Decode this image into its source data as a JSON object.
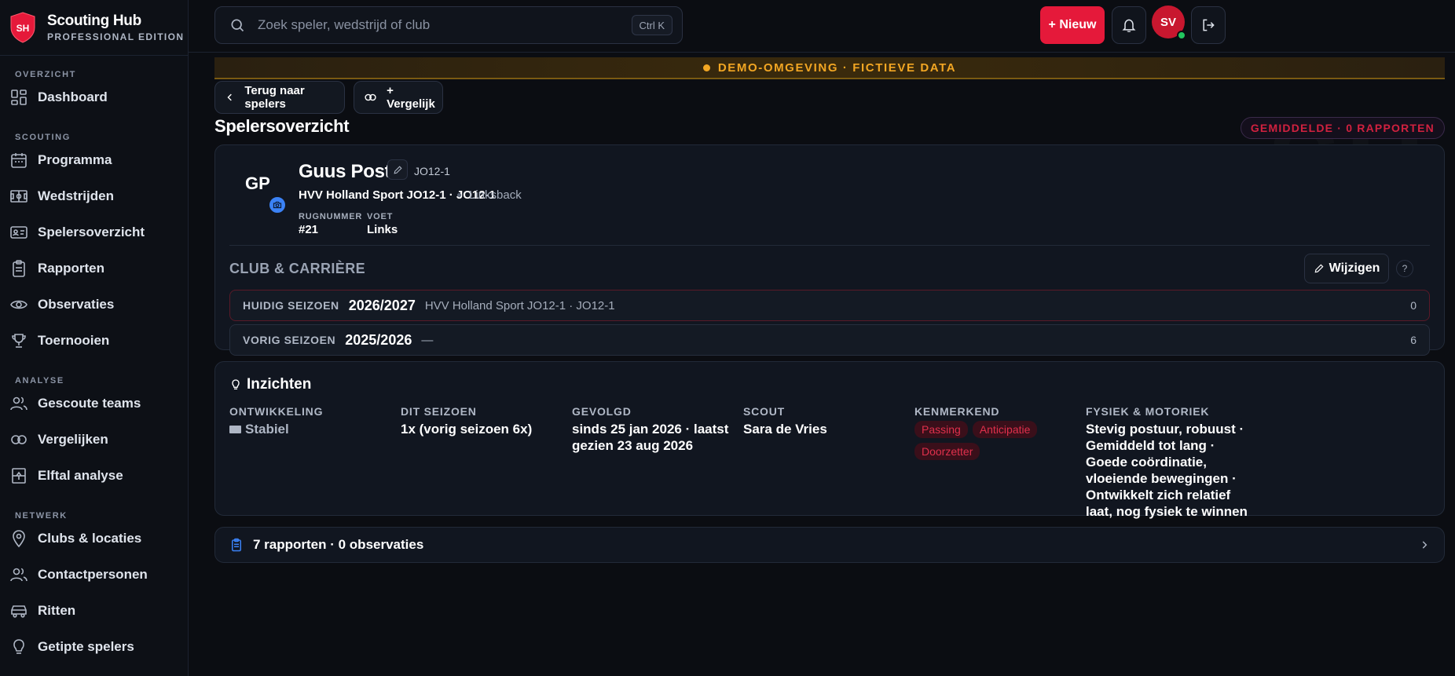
{
  "brand": {
    "logo_text": "SH",
    "title": "Scouting Hub",
    "subtitle": "PROFESSIONAL EDITION"
  },
  "sidebar": {
    "sections": [
      {
        "label": "OVERZICHT",
        "items": [
          {
            "label": "Dashboard",
            "icon": "grid-icon"
          }
        ]
      },
      {
        "label": "SCOUTING",
        "items": [
          {
            "label": "Programma",
            "icon": "calendar-icon"
          },
          {
            "label": "Wedstrijden",
            "icon": "pitch-icon"
          },
          {
            "label": "Spelersoverzicht",
            "icon": "id-card-icon"
          },
          {
            "label": "Rapporten",
            "icon": "clipboard-icon"
          },
          {
            "label": "Observaties",
            "icon": "eye-icon"
          },
          {
            "label": "Toernooien",
            "icon": "trophy-icon"
          }
        ]
      },
      {
        "label": "ANALYSE",
        "items": [
          {
            "label": "Gescoute teams",
            "icon": "users-icon"
          },
          {
            "label": "Vergelijken",
            "icon": "compare-icon"
          },
          {
            "label": "Elftal analyse",
            "icon": "formation-icon"
          }
        ]
      },
      {
        "label": "NETWERK",
        "items": [
          {
            "label": "Clubs & locaties",
            "icon": "map-pin-icon"
          },
          {
            "label": "Contactpersonen",
            "icon": "contacts-icon"
          },
          {
            "label": "Ritten",
            "icon": "car-icon"
          },
          {
            "label": "Getipte spelers",
            "icon": "lightbulb-icon"
          }
        ]
      }
    ]
  },
  "topbar": {
    "search_placeholder": "Zoek speler, wedstrijd of club",
    "shortcut": "Ctrl K",
    "new_label": "+ Nieuw",
    "avatar_initials": "SV"
  },
  "banner": {
    "text": "DEMO-OMGEVING · FICTIEVE DATA"
  },
  "actions": {
    "back_label": "Terug naar spelers",
    "compare_label": "+ Vergelijk"
  },
  "page": {
    "title": "Spelersoverzicht",
    "badge": "GEMIDDELDE · 0 RAPPORTEN"
  },
  "player": {
    "initials": "GP",
    "name": "Guus Post",
    "team_tag": "JO12-1",
    "club_line": "HVV Holland Sport JO12-1 · JO12-1",
    "position": "Linksback",
    "meta": [
      {
        "label": "RUGNUMMER",
        "value": "#21"
      },
      {
        "label": "VOET",
        "value": "Links"
      }
    ]
  },
  "club_career": {
    "title": "CLUB & CARRIÈRE",
    "edit_label": "Wijzigen",
    "help": "?",
    "seasons": [
      {
        "label": "HUIDIG SEIZOEN",
        "year": "2026/2027",
        "club": "HVV Holland Sport JO12-1 · JO12-1",
        "count": "0"
      },
      {
        "label": "VORIG SEIZOEN",
        "year": "2025/2026",
        "club": "—",
        "count": "6"
      }
    ]
  },
  "insights": {
    "title": "Inzichten",
    "columns": [
      {
        "label": "ONTWIKKELING",
        "value": "Stabiel"
      },
      {
        "label": "DIT SEIZOEN",
        "value": "1x (vorig seizoen 6x)"
      },
      {
        "label": "GEVOLGD",
        "value": "sinds 25 jan 2026 · laatst gezien 23 aug 2026"
      },
      {
        "label": "SCOUT",
        "value": "Sara de Vries"
      },
      {
        "label": "KENMERKEND",
        "chips": [
          "Passing",
          "Anticipatie",
          "Doorzetter"
        ]
      },
      {
        "label": "FYSIEK & MOTORIEK",
        "value": "Stevig postuur, robuust · Gemiddeld tot lang · Goede coördinatie, vloeiende bewegingen · Ontwikkelt zich relatief laat, nog fysiek te winnen"
      }
    ]
  },
  "reports": {
    "summary": "7 rapporten · 0 observaties"
  },
  "colors": {
    "accent": "#e5193a",
    "banner": "#f2a623",
    "background": "#0b0d12",
    "card": "#111620",
    "online": "#22c55e",
    "info": "#3b82f6"
  }
}
